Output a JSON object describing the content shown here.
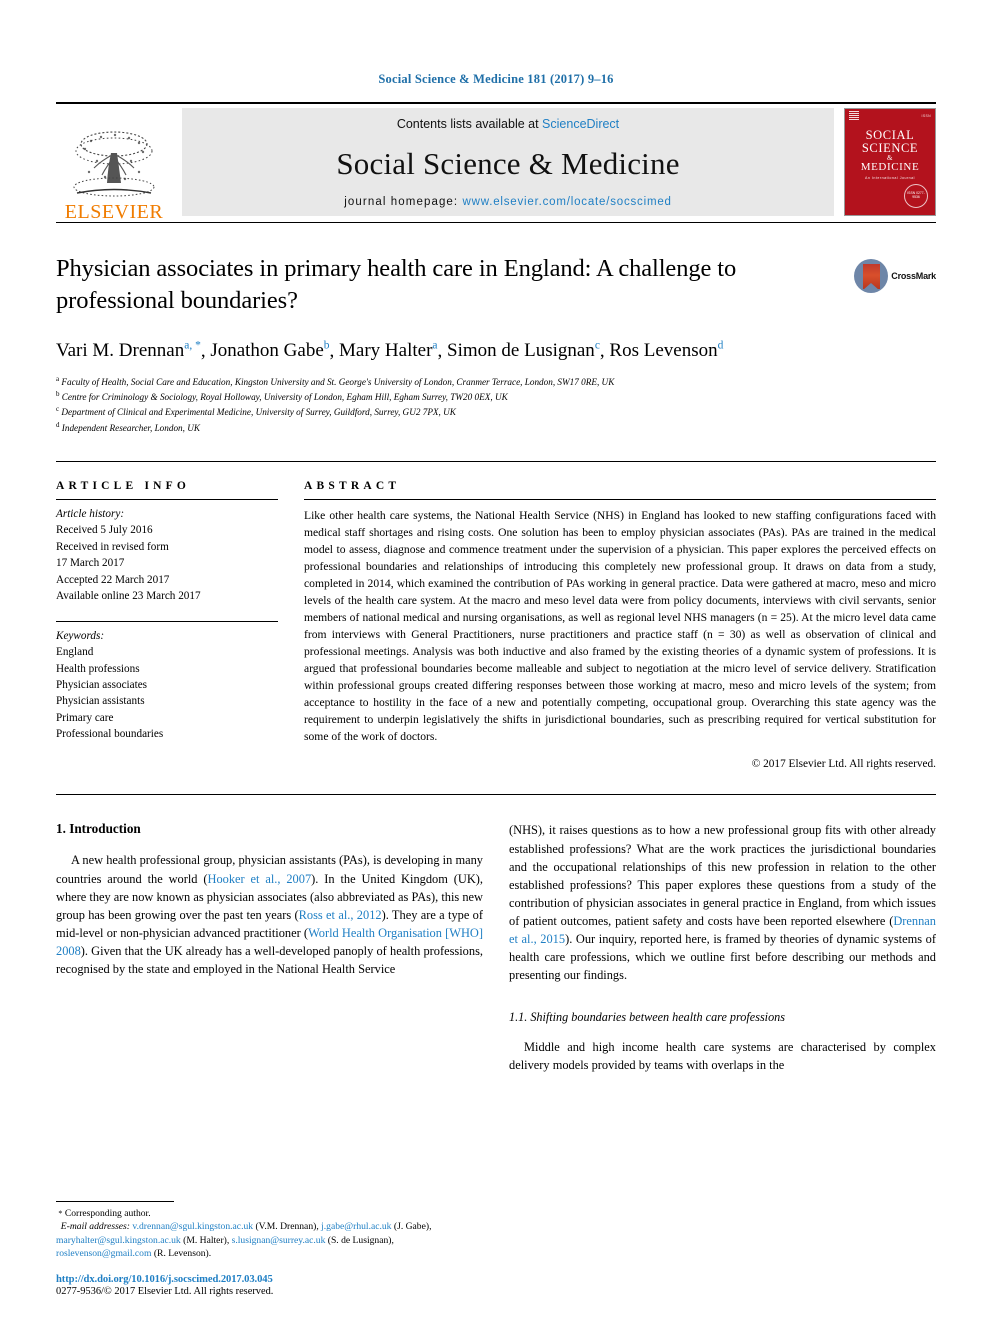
{
  "running_head": "Social Science & Medicine 181 (2017) 9–16",
  "masthead": {
    "publisher_name": "ELSEVIER",
    "contents_prefix": "Contents lists available at ",
    "sciencedirect": "ScienceDirect",
    "journal_title": "Social Science & Medicine",
    "homepage_prefix": "journal homepage: ",
    "homepage_url": "www.elsevier.com/locate/socscimed",
    "cover": {
      "line1": "SOCIAL",
      "line2": "SCIENCE",
      "amp": "&",
      "line3": "MEDICINE",
      "subtitle": "An International Journal",
      "seal_text": "ISSN 0277-9536"
    }
  },
  "article": {
    "title": "Physician associates in primary health care in England: A challenge to professional boundaries?",
    "crossmark_label": "CrossMark",
    "authors": [
      {
        "name": "Vari M. Drennan",
        "marks": "a, *"
      },
      {
        "name": "Jonathon Gabe",
        "marks": "b"
      },
      {
        "name": "Mary Halter",
        "marks": "a"
      },
      {
        "name": "Simon de Lusignan",
        "marks": "c"
      },
      {
        "name": "Ros Levenson",
        "marks": "d"
      }
    ],
    "affiliations": [
      {
        "mark": "a",
        "text": "Faculty of Health, Social Care and Education, Kingston University and St. George's University of London, Cranmer Terrace, London, SW17 0RE, UK"
      },
      {
        "mark": "b",
        "text": "Centre for Criminology & Sociology, Royal Holloway, University of London, Egham Hill, Egham Surrey, TW20 0EX, UK"
      },
      {
        "mark": "c",
        "text": "Department of Clinical and Experimental Medicine, University of Surrey, Guildford, Surrey, GU2 7PX, UK"
      },
      {
        "mark": "d",
        "text": "Independent Researcher, London, UK"
      }
    ]
  },
  "info": {
    "heading": "ARTICLE INFO",
    "history_label": "Article history:",
    "history": [
      "Received 5 July 2016",
      "Received in revised form",
      "17 March 2017",
      "Accepted 22 March 2017",
      "Available online 23 March 2017"
    ],
    "keywords_label": "Keywords:",
    "keywords": [
      "England",
      "Health professions",
      "Physician associates",
      "Physician assistants",
      "Primary care",
      "Professional boundaries"
    ]
  },
  "abstract": {
    "heading": "ABSTRACT",
    "text": "Like other health care systems, the National Health Service (NHS) in England has looked to new staffing configurations faced with medical staff shortages and rising costs. One solution has been to employ physician associates (PAs). PAs are trained in the medical model to assess, diagnose and commence treatment under the supervision of a physician. This paper explores the perceived effects on professional boundaries and relationships of introducing this completely new professional group. It draws on data from a study, completed in 2014, which examined the contribution of PAs working in general practice. Data were gathered at macro, meso and micro levels of the health care system. At the macro and meso level data were from policy documents, interviews with civil servants, senior members of national medical and nursing organisations, as well as regional level NHS managers (n = 25). At the micro level data came from interviews with General Practitioners, nurse practitioners and practice staff (n = 30) as well as observation of clinical and professional meetings. Analysis was both inductive and also framed by the existing theories of a dynamic system of professions. It is argued that professional boundaries become malleable and subject to negotiation at the micro level of service delivery. Stratification within professional groups created differing responses between those working at macro, meso and micro levels of the system; from acceptance to hostility in the face of a new and potentially competing, occupational group. Overarching this state agency was the requirement to underpin legislatively the shifts in jurisdictional boundaries, such as prescribing required for vertical substitution for some of the work of doctors.",
    "copyright": "© 2017 Elsevier Ltd. All rights reserved."
  },
  "body": {
    "section_number_title": "1. Introduction",
    "left_para_1": "A new health professional group, physician assistants (PAs), is developing in many countries around the world (",
    "left_cite_1": "Hooker et al., 2007",
    "left_para_2": "). In the United Kingdom (UK), where they are now known as physician associates (also abbreviated as PAs), this new group has been growing over the past ten years (",
    "left_cite_2": "Ross et al., 2012",
    "left_para_3": "). They are a type of mid-level or non-physician advanced practitioner (",
    "left_cite_3": "World Health Organisation [WHO] 2008",
    "left_para_4": "). Given that the UK already has a well-developed panoply of health professions, recognised by the state and employed in the National Health Service",
    "right_para_1": "(NHS), it raises questions as to how a new professional group fits with other already established professions? What are the work practices the jurisdictional boundaries and the occupational relationships of this new profession in relation to the other established professions? This paper explores these questions from a study of the contribution of physician associates in general practice in England, from which issues of patient outcomes, patient safety and costs have been reported elsewhere (",
    "right_cite_1": "Drennan et al., 2015",
    "right_para_2": "). Our inquiry, reported here, is framed by theories of dynamic systems of health care professions, which we outline first before describing our methods and presenting our findings.",
    "subsection_title": "1.1. Shifting boundaries between health care professions",
    "right_para_3": "Middle and high income health care systems are characterised by complex delivery models provided by teams with overlaps in the"
  },
  "footnote": {
    "corresponding_marker": "*",
    "corresponding_label": "Corresponding author.",
    "email_label": "E-mail addresses:",
    "emails": [
      {
        "address": "v.drennan@sgul.kingston.ac.uk",
        "person": "(V.M. Drennan)"
      },
      {
        "address": "j.gabe@rhul.ac.uk",
        "person": "(J. Gabe)"
      },
      {
        "address": "maryhalter@sgul.kingston.ac.uk",
        "person": "(M. Halter)"
      },
      {
        "address": "s.lusignan@surrey.ac.uk",
        "person": "(S. de Lusignan)"
      },
      {
        "address": "roslevenson@gmail.com",
        "person": "(R. Levenson)"
      }
    ],
    "doi": "http://dx.doi.org/10.1016/j.socscimed.2017.03.045",
    "issn_line": "0277-9536/© 2017 Elsevier Ltd. All rights reserved."
  },
  "colors": {
    "link_blue": "#1f7fc4",
    "header_blue": "#1f6fa8",
    "elsevier_orange": "#f07c00",
    "cover_red": "#b3121d"
  }
}
